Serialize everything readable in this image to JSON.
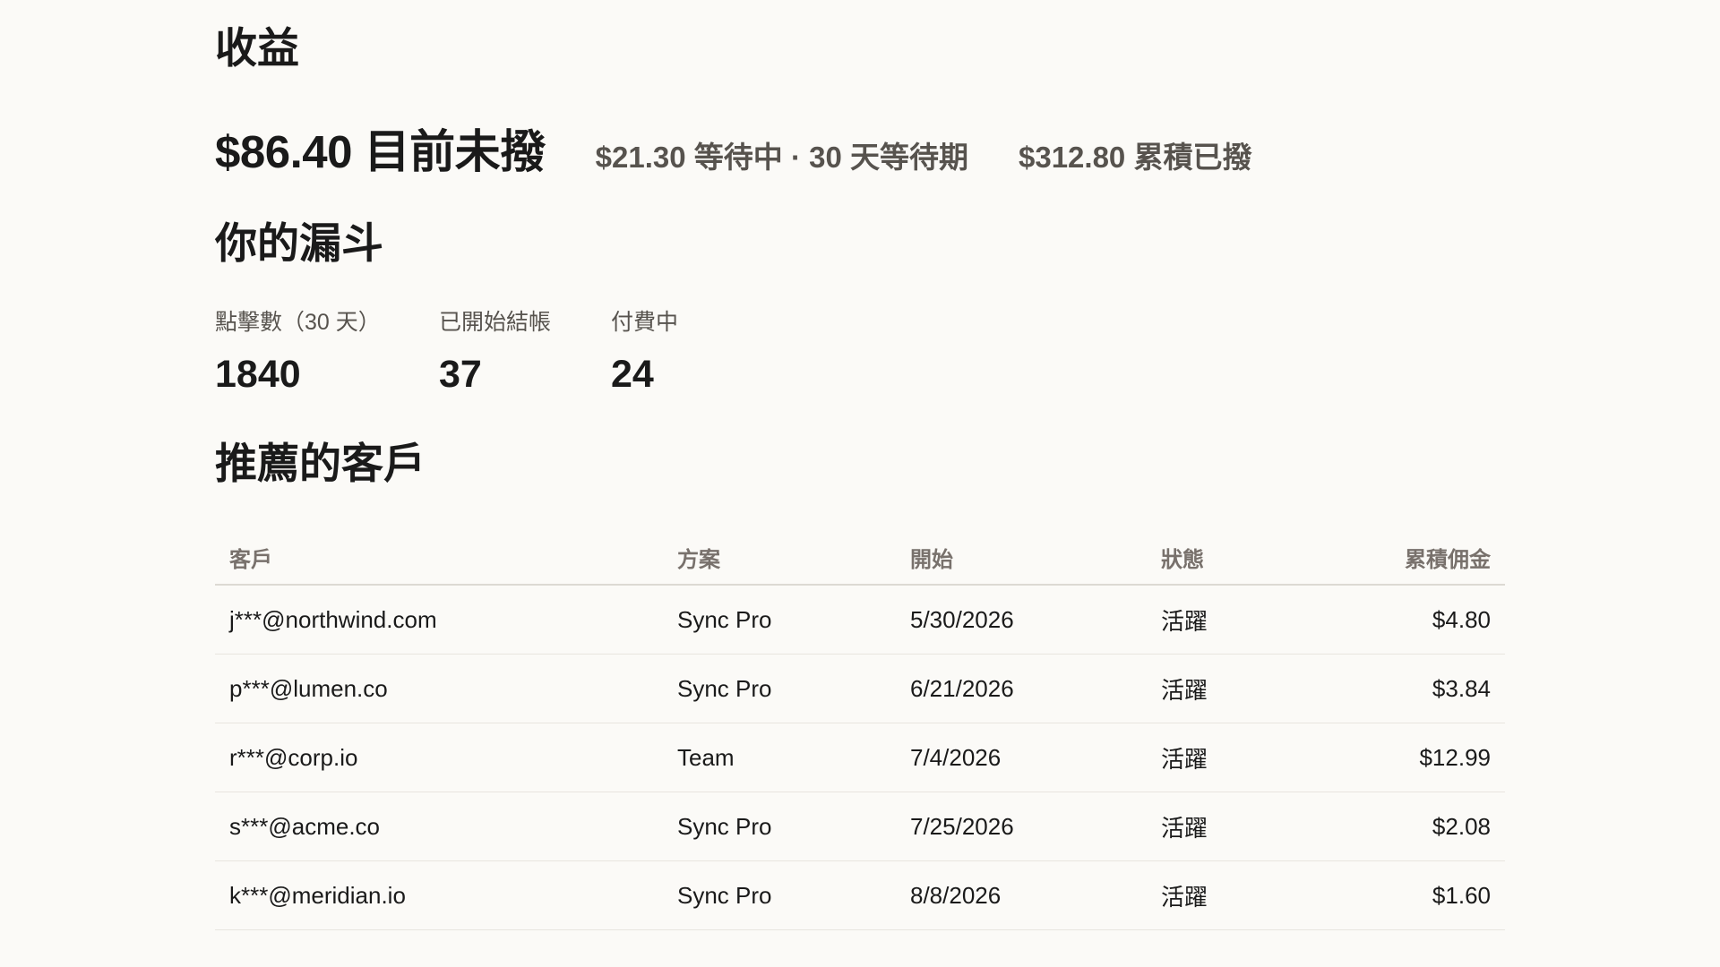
{
  "page": {
    "title": "收益"
  },
  "earnings": {
    "unpaid": "$86.40 目前未撥",
    "pending": "$21.30 等待中 · 30 天等待期",
    "paid_total": "$312.80 累積已撥"
  },
  "funnel": {
    "title": "你的漏斗",
    "stats": [
      {
        "label": "點擊數（30 天）",
        "value": "1840"
      },
      {
        "label": "已開始結帳",
        "value": "37"
      },
      {
        "label": "付費中",
        "value": "24"
      }
    ]
  },
  "customers": {
    "title": "推薦的客戶",
    "columns": [
      "客戶",
      "方案",
      "開始",
      "狀態",
      "累積佣金"
    ],
    "rows": [
      {
        "customer": "j***@northwind.com",
        "plan": "Sync Pro",
        "start": "5/30/2026",
        "status": "活躍",
        "commission": "$4.80"
      },
      {
        "customer": "p***@lumen.co",
        "plan": "Sync Pro",
        "start": "6/21/2026",
        "status": "活躍",
        "commission": "$3.84"
      },
      {
        "customer": "r***@corp.io",
        "plan": "Team",
        "start": "7/4/2026",
        "status": "活躍",
        "commission": "$12.99"
      },
      {
        "customer": "s***@acme.co",
        "plan": "Sync Pro",
        "start": "7/25/2026",
        "status": "活躍",
        "commission": "$2.08"
      },
      {
        "customer": "k***@meridian.io",
        "plan": "Sync Pro",
        "start": "8/8/2026",
        "status": "活躍",
        "commission": "$1.60"
      }
    ]
  }
}
